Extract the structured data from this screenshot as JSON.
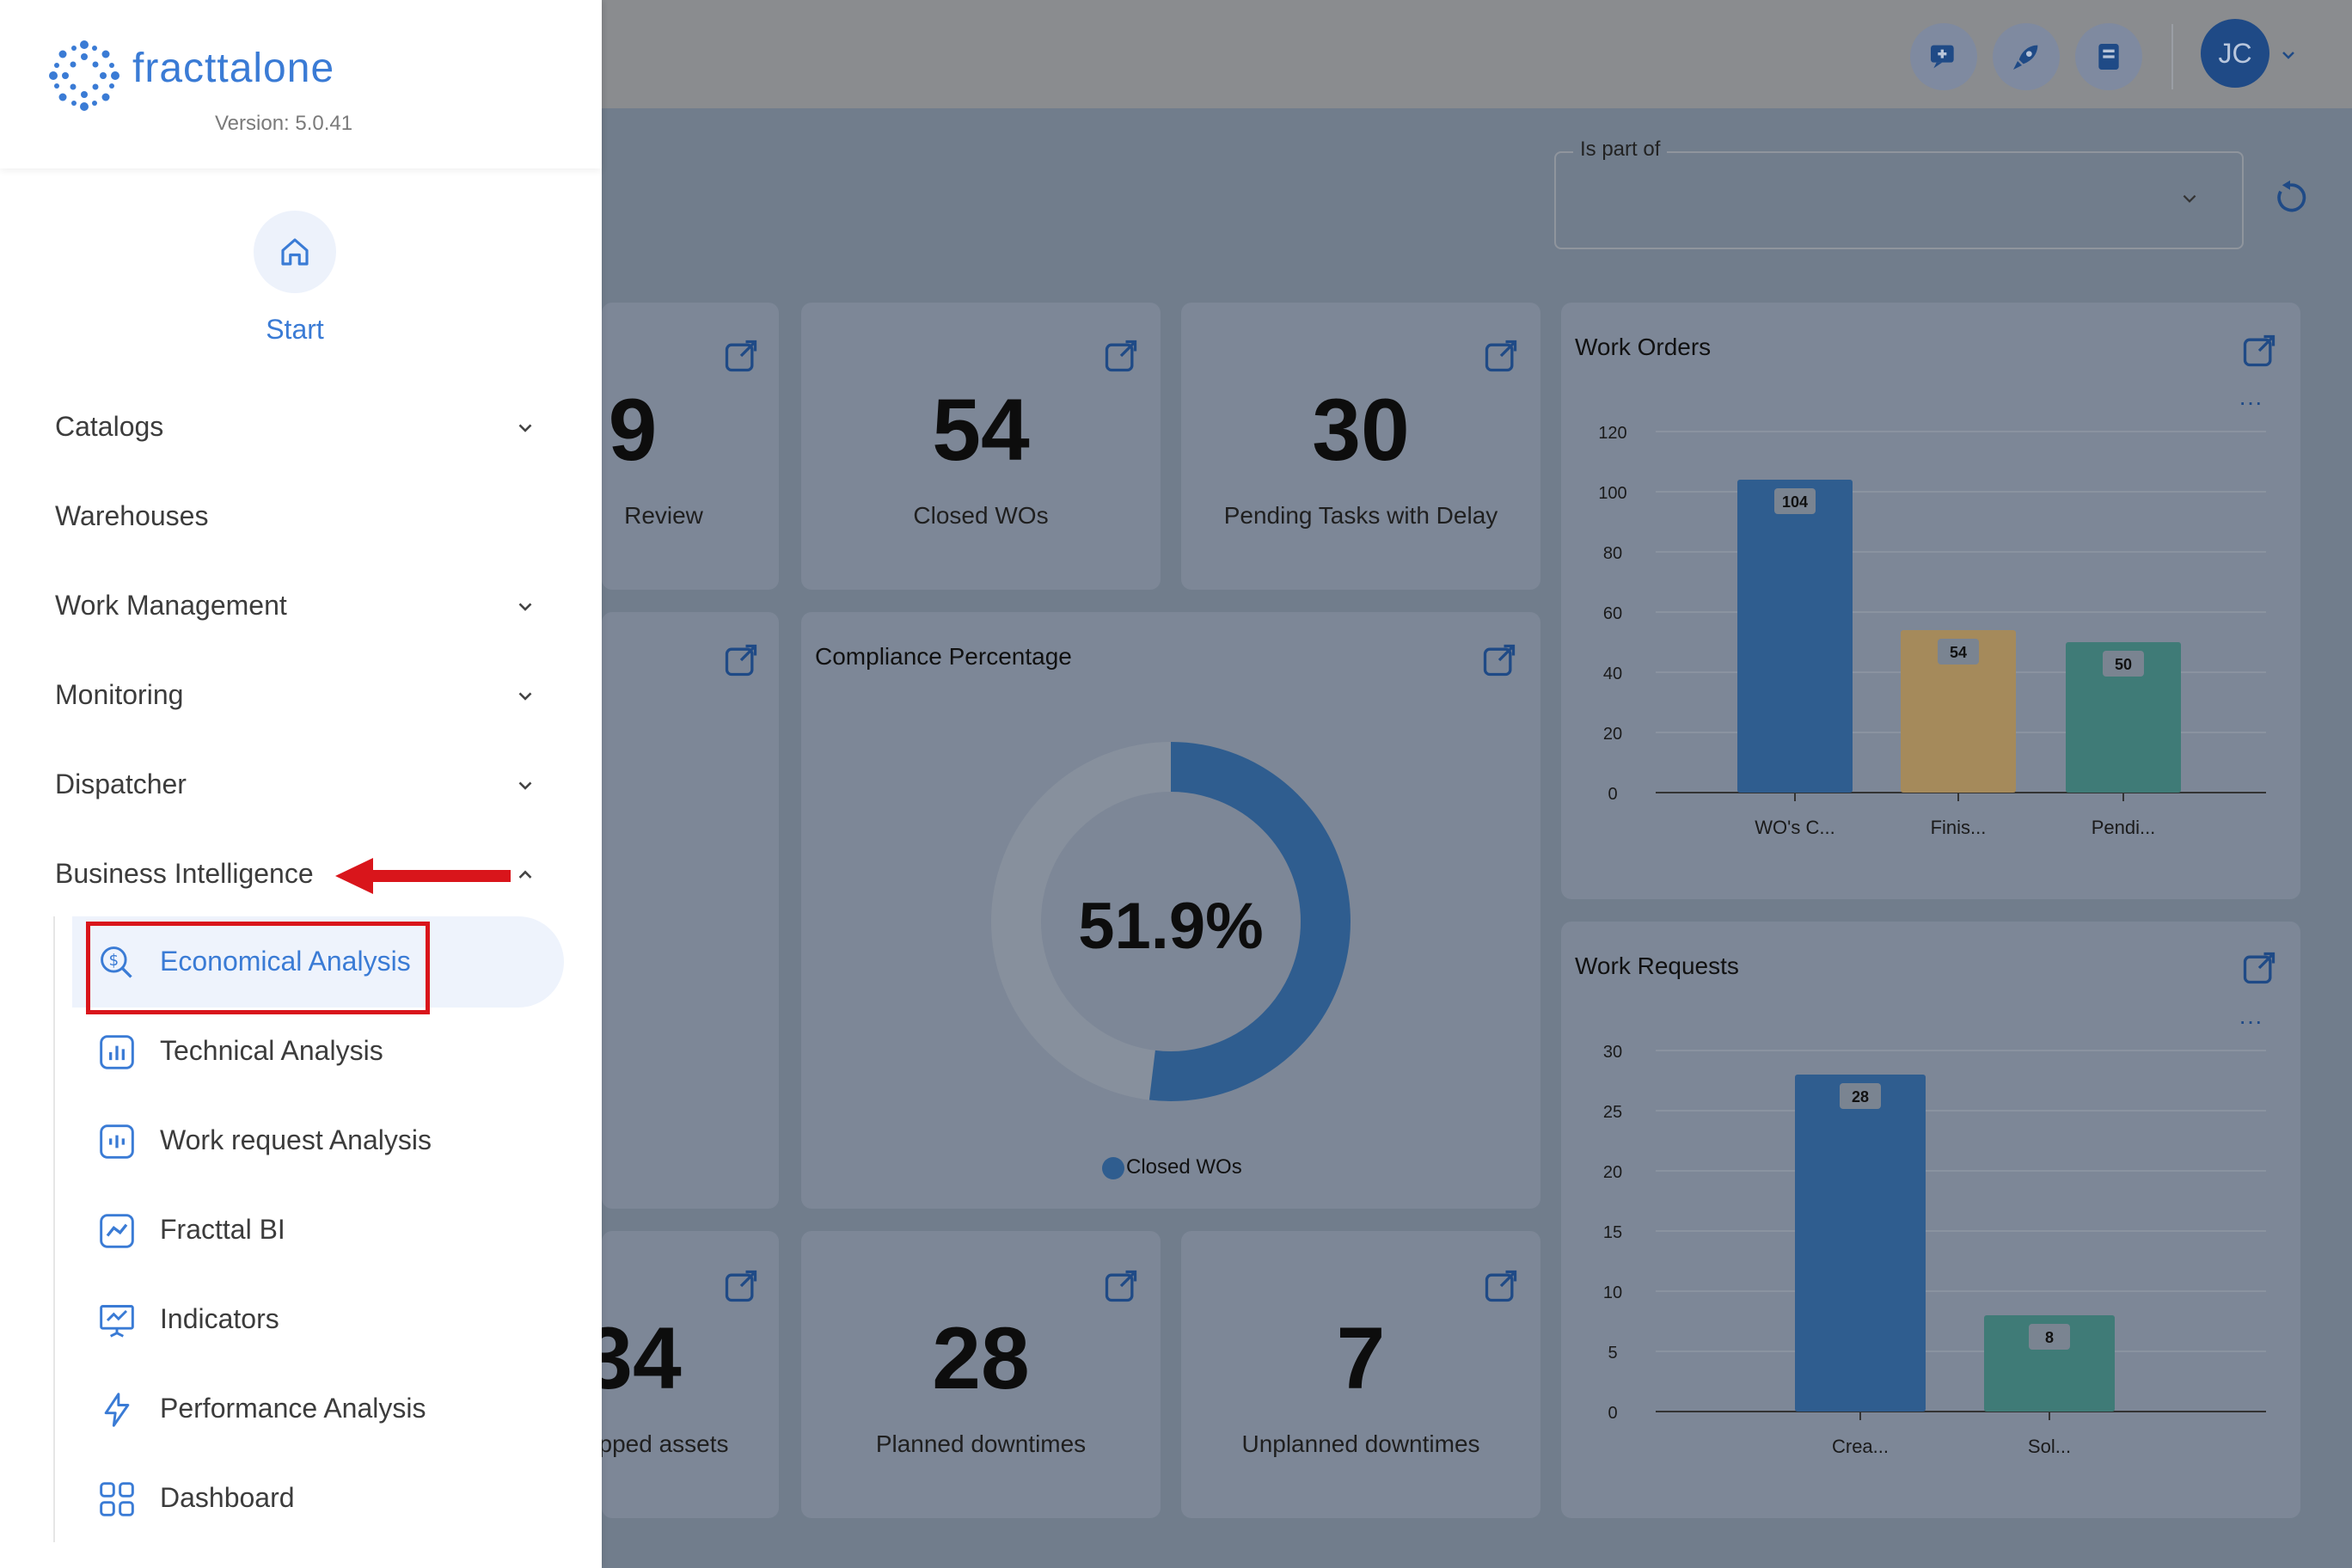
{
  "brand": {
    "name": "fracttalone",
    "version": "Version: 5.0.41"
  },
  "sidebar": {
    "start_label": "Start",
    "nav": [
      {
        "label": "Catalogs",
        "expandable": true
      },
      {
        "label": "Warehouses",
        "expandable": false
      },
      {
        "label": "Work Management",
        "expandable": true
      },
      {
        "label": "Monitoring",
        "expandable": true
      },
      {
        "label": "Dispatcher",
        "expandable": true
      },
      {
        "label": "Business Intelligence",
        "expandable": true,
        "expanded": true
      }
    ],
    "bi_items": [
      {
        "label": "Economical Analysis",
        "icon": "dollar-search-icon",
        "active": true
      },
      {
        "label": "Technical Analysis",
        "icon": "bar-chart-icon"
      },
      {
        "label": "Work request Analysis",
        "icon": "wave-icon"
      },
      {
        "label": "Fracttal BI",
        "icon": "line-chart-icon"
      },
      {
        "label": "Indicators",
        "icon": "presentation-icon"
      },
      {
        "label": "Performance Analysis",
        "icon": "lightning-icon"
      },
      {
        "label": "Dashboard",
        "icon": "grid-icon"
      }
    ]
  },
  "topbar": {
    "avatar_initials": "JC"
  },
  "filter": {
    "label": "Is part of",
    "value": ""
  },
  "cards": {
    "review": {
      "value": "9",
      "label": "Review"
    },
    "closed": {
      "value": "54",
      "label": "Closed WOs"
    },
    "pending": {
      "value": "30",
      "label": "Pending Tasks with Delay"
    },
    "stopped": {
      "value": "34",
      "label": "pped assets"
    },
    "planned": {
      "value": "28",
      "label": "Planned downtimes"
    },
    "unplanned": {
      "value": "7",
      "label": "Unplanned downtimes"
    }
  },
  "compliance": {
    "title": "Compliance Percentage",
    "value_label": "51.9%",
    "percent": 51.9,
    "legend": "Closed WOs"
  },
  "chart_data": [
    {
      "type": "bar",
      "title": "Work Orders",
      "categories": [
        "WO's C...",
        "Finis...",
        "Pendi..."
      ],
      "values": [
        104,
        54,
        50
      ],
      "ylim": [
        0,
        120
      ],
      "yticks": [
        0,
        20,
        40,
        60,
        80,
        100,
        120
      ],
      "colors": [
        "#2f5d8f",
        "#a58a5b",
        "#3f7b77"
      ]
    },
    {
      "type": "bar",
      "title": "Work Requests",
      "categories": [
        "Crea...",
        "Sol..."
      ],
      "values": [
        28,
        8
      ],
      "ylim": [
        0,
        30
      ],
      "yticks": [
        0,
        5,
        10,
        15,
        20,
        25,
        30
      ],
      "colors": [
        "#2f5d8f",
        "#3f7b77"
      ]
    }
  ]
}
